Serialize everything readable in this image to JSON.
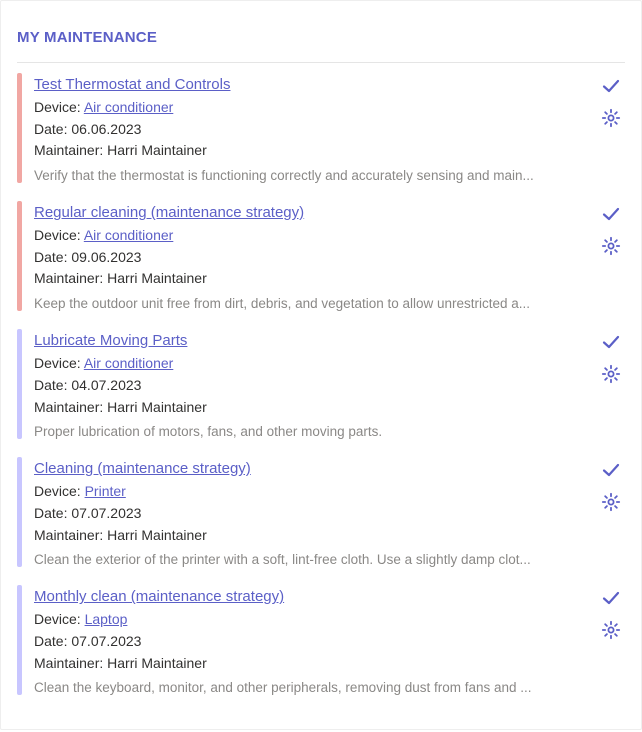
{
  "section_title": "MY MAINTENANCE",
  "labels": {
    "device_prefix": "Device: ",
    "date_prefix": "Date: ",
    "maintainer_prefix": "Maintainer: "
  },
  "colors": {
    "accent": "#5b5fc7",
    "overdue_bar": "#f1a7a3",
    "upcoming_bar": "#c8c6ff",
    "desc_text": "#8a8886"
  },
  "items": [
    {
      "title": "Test Thermostat and Controls",
      "device": "Air conditioner",
      "date": "06.06.2023",
      "maintainer": "Harri Maintainer",
      "description": "Verify that the thermostat is functioning correctly and accurately sensing and main...",
      "status": "overdue"
    },
    {
      "title": "Regular cleaning (maintenance strategy)",
      "device": "Air conditioner",
      "date": "09.06.2023",
      "maintainer": "Harri Maintainer",
      "description": "Keep the outdoor unit free from dirt, debris, and vegetation to allow unrestricted a...",
      "status": "overdue"
    },
    {
      "title": "Lubricate Moving Parts",
      "device": "Air conditioner",
      "date": "04.07.2023",
      "maintainer": "Harri Maintainer",
      "description": "Proper lubrication of motors, fans, and other moving parts.",
      "status": "upcoming"
    },
    {
      "title": "Cleaning (maintenance strategy)",
      "device": "Printer",
      "date": "07.07.2023",
      "maintainer": "Harri Maintainer",
      "description": "Clean the exterior of the printer with a soft, lint-free cloth. Use a slightly damp clot...",
      "status": "upcoming"
    },
    {
      "title": "Monthly clean (maintenance strategy)",
      "device": "Laptop",
      "date": "07.07.2023",
      "maintainer": "Harri Maintainer",
      "description": "Clean the keyboard, monitor, and other peripherals, removing dust from fans and ...",
      "status": "upcoming"
    }
  ]
}
